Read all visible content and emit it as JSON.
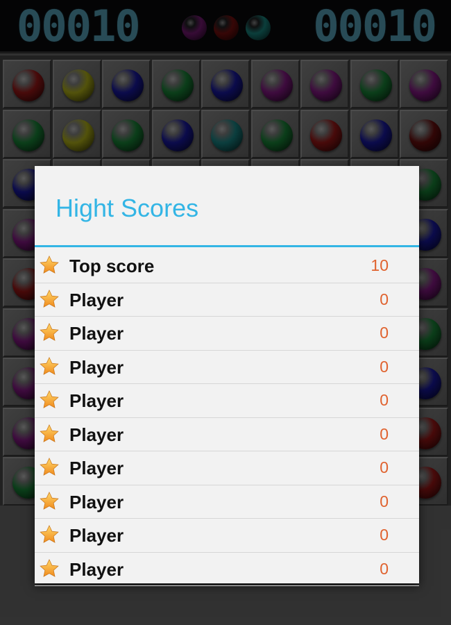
{
  "top_bar": {
    "score_left": "00010",
    "score_right": "00010",
    "next_balls": [
      "#7a1a78",
      "#7a1010",
      "#1a8a84"
    ]
  },
  "board": {
    "palette": {
      "r": "#a01818",
      "y": "#b8b81a",
      "b": "#1a1aa8",
      "g": "#1a8a3a",
      "m": "#8a1a8a",
      "c": "#1a8a8a",
      "d": "#6e1010"
    },
    "rows": [
      [
        "r",
        "y",
        "b",
        "g",
        "b",
        "m",
        "m",
        "g",
        "m"
      ],
      [
        "g",
        "y",
        "g",
        "b",
        "c",
        "g",
        "r",
        "b",
        "d"
      ],
      [
        "b",
        "",
        "",
        "",
        "",
        "",
        "",
        "",
        "g"
      ],
      [
        "m",
        "",
        "",
        "",
        "",
        "",
        "",
        "",
        "b"
      ],
      [
        "r",
        "",
        "",
        "",
        "",
        "",
        "",
        "",
        "m"
      ],
      [
        "m",
        "",
        "",
        "",
        "",
        "",
        "",
        "",
        "g"
      ],
      [
        "m",
        "",
        "",
        "",
        "",
        "",
        "",
        "",
        "b"
      ],
      [
        "m",
        "",
        "",
        "",
        "",
        "",
        "",
        "",
        "r"
      ],
      [
        "g",
        "",
        "",
        "",
        "",
        "",
        "",
        "",
        "r"
      ]
    ]
  },
  "dialog": {
    "title": "Hight Scores",
    "accent": "#33b5e5",
    "scores": [
      {
        "name": "Top score",
        "score": "10"
      },
      {
        "name": "Player",
        "score": "0"
      },
      {
        "name": "Player",
        "score": "0"
      },
      {
        "name": "Player",
        "score": "0"
      },
      {
        "name": "Player",
        "score": "0"
      },
      {
        "name": "Player",
        "score": "0"
      },
      {
        "name": "Player",
        "score": "0"
      },
      {
        "name": "Player",
        "score": "0"
      },
      {
        "name": "Player",
        "score": "0"
      },
      {
        "name": "Player",
        "score": "0"
      }
    ]
  }
}
